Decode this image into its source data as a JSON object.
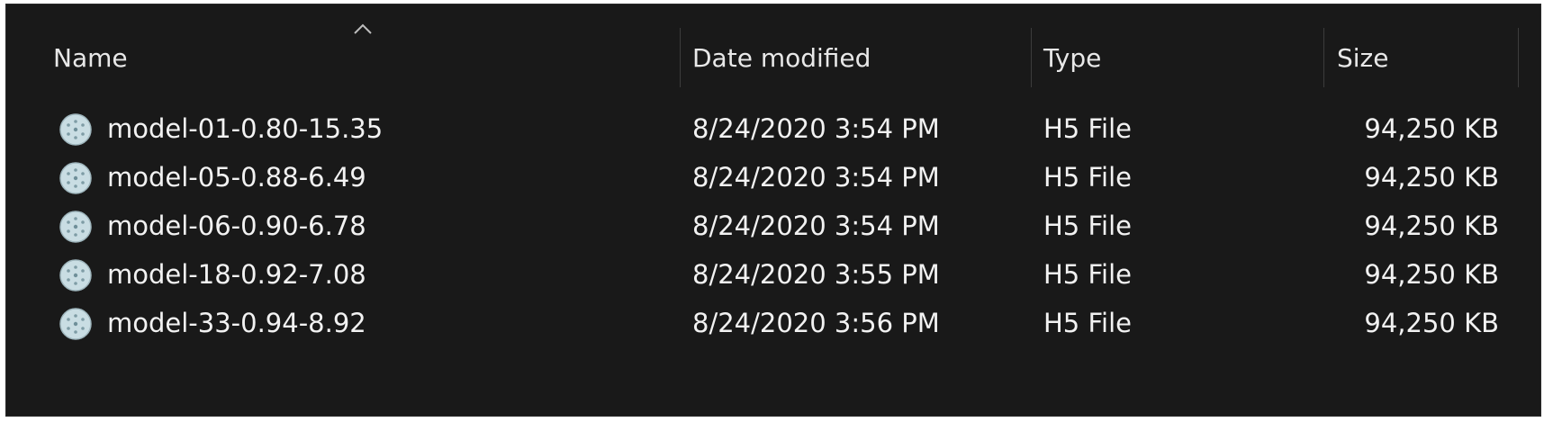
{
  "columns": {
    "name": "Name",
    "date_modified": "Date modified",
    "type": "Type",
    "size": "Size"
  },
  "sort": {
    "column": "name",
    "direction": "ascending",
    "icon": "chevron-up-icon"
  },
  "colors": {
    "background": "#191919",
    "text": "#f2f2f2",
    "divider": "#3c3c3c"
  },
  "files": [
    {
      "name": "model-01-0.80-15.35",
      "date_modified": "8/24/2020 3:54 PM",
      "type": "H5 File",
      "size": "94,250 KB",
      "icon": "h5-file-icon"
    },
    {
      "name": "model-05-0.88-6.49",
      "date_modified": "8/24/2020 3:54 PM",
      "type": "H5 File",
      "size": "94,250 KB",
      "icon": "h5-file-icon"
    },
    {
      "name": "model-06-0.90-6.78",
      "date_modified": "8/24/2020 3:54 PM",
      "type": "H5 File",
      "size": "94,250 KB",
      "icon": "h5-file-icon"
    },
    {
      "name": "model-18-0.92-7.08",
      "date_modified": "8/24/2020 3:55 PM",
      "type": "H5 File",
      "size": "94,250 KB",
      "icon": "h5-file-icon"
    },
    {
      "name": "model-33-0.94-8.92",
      "date_modified": "8/24/2020 3:56 PM",
      "type": "H5 File",
      "size": "94,250 KB",
      "icon": "h5-file-icon"
    }
  ]
}
